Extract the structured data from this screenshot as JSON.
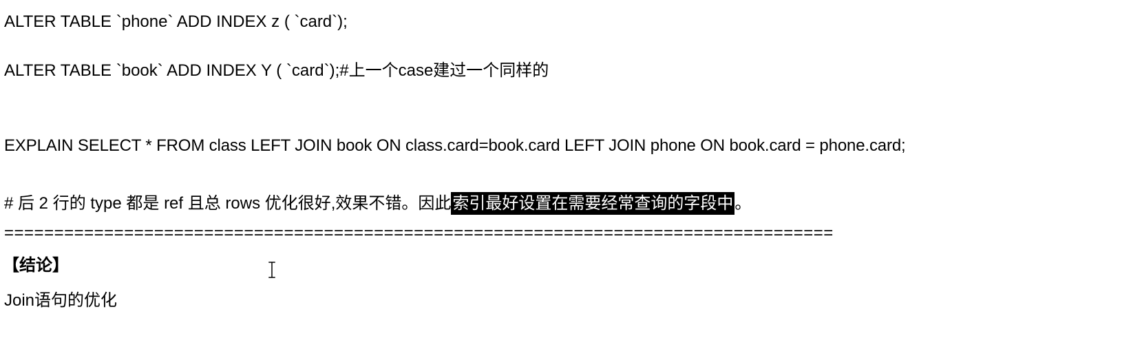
{
  "document": {
    "line1": "ALTER TABLE `phone` ADD INDEX z ( `card`);",
    "line2": "ALTER TABLE `book` ADD INDEX Y ( `card`);#上一个case建过一个同样的",
    "line3": "EXPLAIN SELECT * FROM class LEFT JOIN book ON class.card=book.card LEFT JOIN phone ON book.card = phone.card;",
    "line4": {
      "plain_before": "# 后 2 行的 type 都是 ref 且总 rows 优化很好,效果不错。因此",
      "highlighted": "索引最好设置在需要经常查询的字段中",
      "plain_after": "。"
    },
    "separator": "===================================================================================",
    "conclusion_heading": "【结论】",
    "conclusion_item": "Join语句的优化"
  },
  "colors": {
    "text": "#000000",
    "background": "#ffffff",
    "highlight_background": "#000000",
    "highlight_text": "#ffffff"
  },
  "icons": {
    "cursor": "text-cursor-icon"
  }
}
